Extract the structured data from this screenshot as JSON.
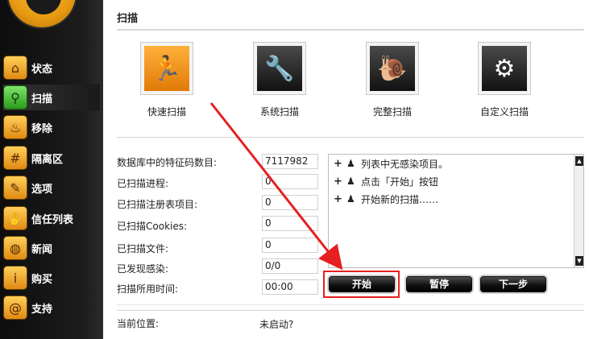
{
  "sidebar": {
    "items": [
      {
        "label": "状态",
        "icon": "home-icon"
      },
      {
        "label": "扫描",
        "icon": "magnifier-icon"
      },
      {
        "label": "移除",
        "icon": "fire-icon"
      },
      {
        "label": "隔离区",
        "icon": "grid-icon"
      },
      {
        "label": "选项",
        "icon": "wrench-icon"
      },
      {
        "label": "信任列表",
        "icon": "hand-icon"
      },
      {
        "label": "新闻",
        "icon": "globe-icon"
      },
      {
        "label": "购买",
        "icon": "info-icon"
      },
      {
        "label": "支持",
        "icon": "at-icon"
      }
    ],
    "active_index": 1
  },
  "main": {
    "title": "扫描",
    "scan_options": [
      {
        "label": "快速扫描",
        "icon": "running-man-icon"
      },
      {
        "label": "系统扫描",
        "icon": "wrench-icon"
      },
      {
        "label": "完整扫描",
        "icon": "snail-icon"
      },
      {
        "label": "自定义扫描",
        "icon": "gear-icon"
      }
    ],
    "fields": [
      {
        "label": "数据库中的特征码数目:",
        "value": "7117982"
      },
      {
        "label": "已扫描进程:",
        "value": "0"
      },
      {
        "label": "已扫描注册表项目:",
        "value": "0"
      },
      {
        "label": "已扫描Cookies:",
        "value": "0"
      },
      {
        "label": "已扫描文件:",
        "value": "0"
      },
      {
        "label": "已发现感染:",
        "value": "0/0"
      },
      {
        "label": "扫描所用时间:",
        "value": "00:00"
      }
    ],
    "log": [
      {
        "text": "列表中无感染项目。"
      },
      {
        "text": "点击「开始」按钮"
      },
      {
        "text": "开始新的扫描……"
      }
    ],
    "buttons": {
      "start": "开始",
      "pause": "暂停",
      "next": "下一步"
    },
    "location": {
      "label": "当前位置:",
      "value": "未启动?"
    }
  },
  "colors": {
    "highlight": "#e52020",
    "sidebar_bg": "#111111",
    "accent_orange": "#f0a020"
  }
}
